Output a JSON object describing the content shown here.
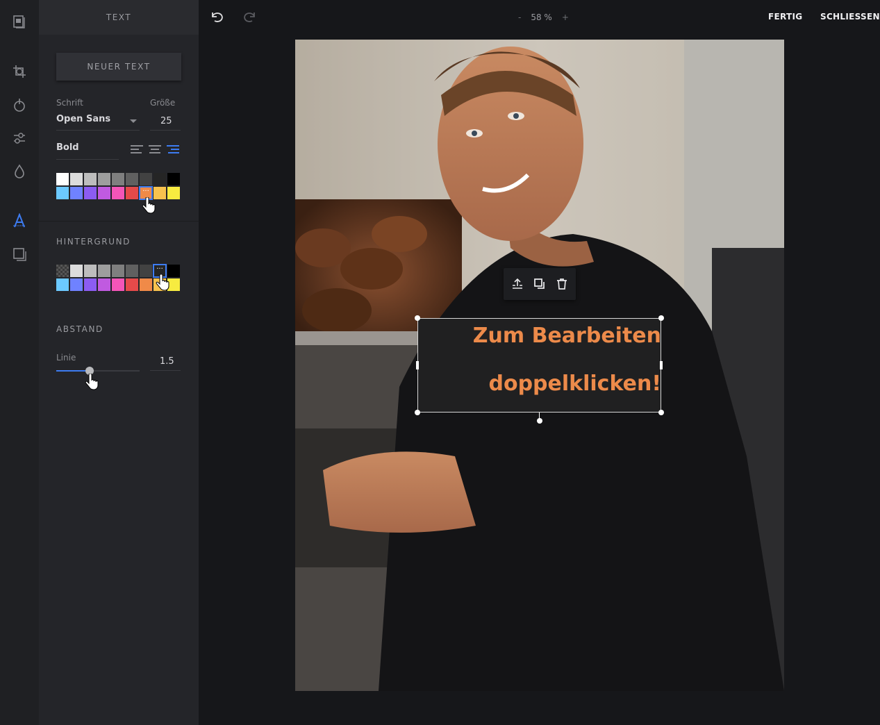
{
  "panel": {
    "title": "TEXT",
    "new_text_button": "NEUER TEXT",
    "font_label": "Schrift",
    "font_value": "Open Sans",
    "size_label": "Größe",
    "size_value": "25",
    "weight_value": "Bold",
    "text_colors": [
      "#ffffff",
      "#dcdcdc",
      "#bdbdbd",
      "#9e9e9e",
      "#7f7f7f",
      "#606060",
      "#424242",
      "#252525",
      "#000000",
      "#6cc9ff",
      "#6f82ff",
      "#8c5cf2",
      "#c05ae0",
      "#f455b8",
      "#e54a4a",
      "#f08a48",
      "#f7c24e",
      "#f7eb40"
    ],
    "text_color_selected": 15,
    "background_title": "HINTERGRUND",
    "bg_colors": [
      "transparent",
      "#dcdcdc",
      "#bdbdbd",
      "#9e9e9e",
      "#7f7f7f",
      "#606060",
      "#424242",
      "#252525",
      "#000000",
      "#6cc9ff",
      "#6f82ff",
      "#8c5cf2",
      "#c05ae0",
      "#f455b8",
      "#e54a4a",
      "#f08a48",
      "#f7c24e",
      "#f7eb40"
    ],
    "bg_color_selected": 7,
    "spacing_title": "ABSTAND",
    "line_label": "Linie",
    "line_value": "1.5",
    "line_slider_fraction": 0.4
  },
  "topbar": {
    "zoom_minus": "-",
    "zoom_value": "58 %",
    "zoom_plus": "+",
    "done_label": "FERTIG",
    "close_label": "SCHLIESSEN"
  },
  "canvas": {
    "text_line_1": "Zum Bearbeiten",
    "text_line_2": "doppelklicken!",
    "text_color": "#ec8a4a"
  }
}
